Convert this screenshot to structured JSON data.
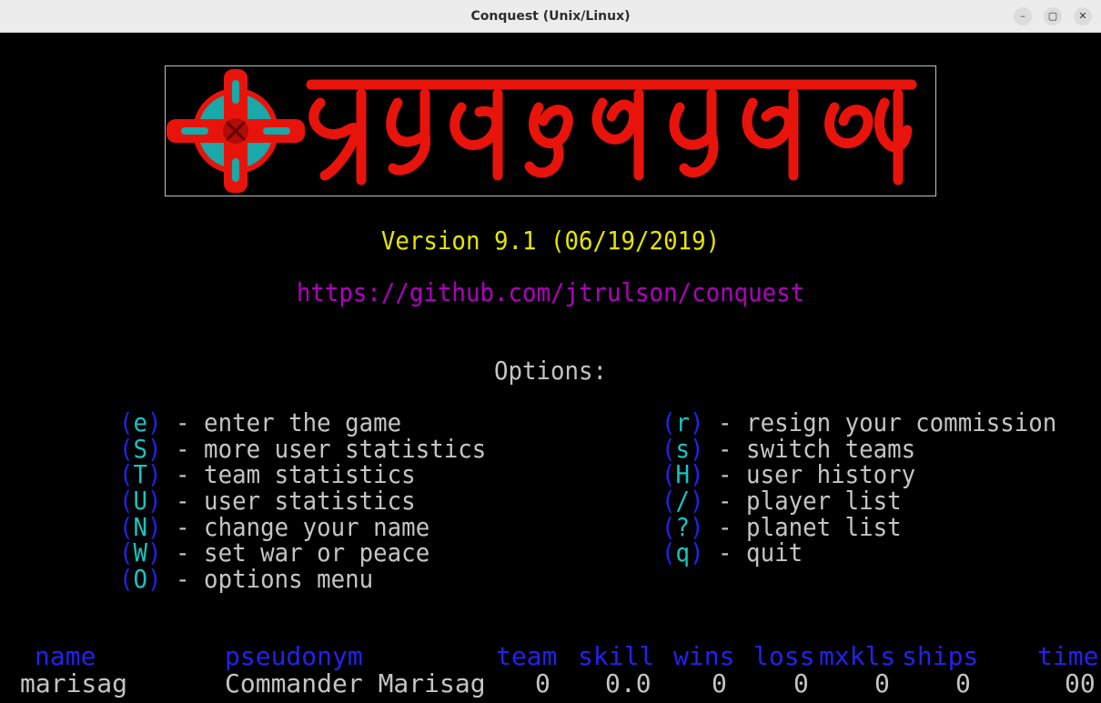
{
  "window": {
    "title": "Conquest (Unix/Linux)",
    "minimize_glyph": "–",
    "maximize_glyph": "▢",
    "close_glyph": "✕"
  },
  "version": "Version 9.1 (06/19/2019)",
  "url": "https://github.com/jtrulson/conquest",
  "options_title": "Options:",
  "options_left": [
    {
      "key": "e",
      "label": " - enter the game"
    },
    {
      "key": "S",
      "label": " - more user statistics"
    },
    {
      "key": "T",
      "label": " - team statistics"
    },
    {
      "key": "U",
      "label": " - user statistics"
    },
    {
      "key": "N",
      "label": " - change your name"
    },
    {
      "key": "W",
      "label": " - set war or peace"
    },
    {
      "key": "O",
      "label": " - options menu"
    }
  ],
  "options_right": [
    {
      "key": "r",
      "label": " - resign your commission"
    },
    {
      "key": "s",
      "label": " - switch teams"
    },
    {
      "key": "H",
      "label": " - user history"
    },
    {
      "key": "/",
      "label": " - player list"
    },
    {
      "key": "?",
      "label": " - planet list"
    },
    {
      "key": "q",
      "label": " - quit"
    }
  ],
  "stats": {
    "headers": {
      "name": "name",
      "pseudonym": "pseudonym",
      "team": "team",
      "skill": "skill",
      "wins": "wins",
      "loss": "loss",
      "mxkls": "mxkls",
      "ships": "ships",
      "time": "time"
    },
    "row": {
      "name": "marisag",
      "pseudonym": "Commander Marisag",
      "team": "0",
      "skill": "0.0",
      "wins": "0",
      "loss": "0",
      "mxkls": "0",
      "ships": "0",
      "time": "00"
    }
  },
  "colors": {
    "logo_red": "#e8140c",
    "logo_teal": "#1aa8a8",
    "version": "#e5e500",
    "url": "#b000c0",
    "key": "#18c4c4",
    "paren": "#2222ee",
    "text": "#c4c4c4"
  },
  "icons": [
    "conquest-logo-cross-icon"
  ]
}
